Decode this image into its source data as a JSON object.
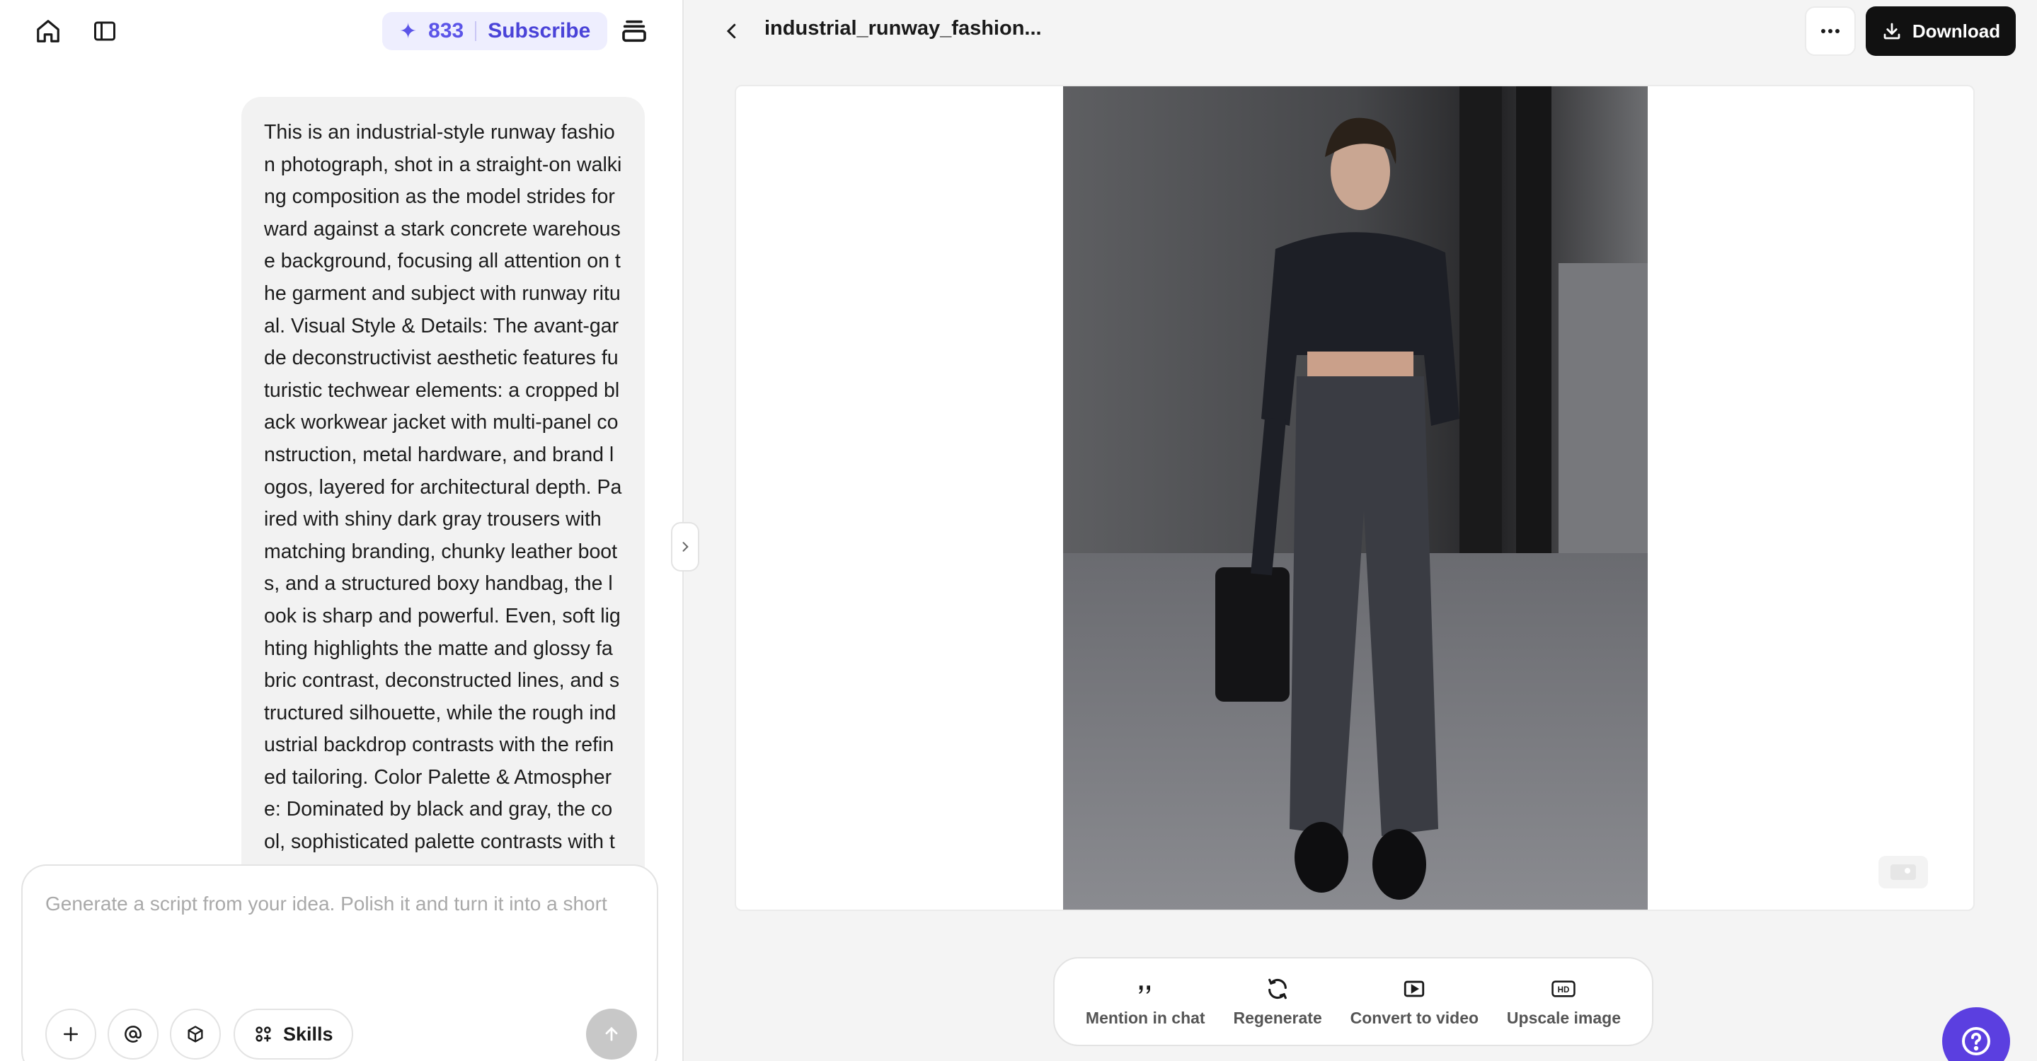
{
  "left_panel": {
    "credits": {
      "count": "833",
      "subscribe_label": "Subscribe"
    },
    "chat_message": "This is an industrial-style runway fashion photograph, shot in a straight-on walking composition as the model strides forward against a stark concrete warehouse background, focusing all attention on the garment and subject with runway ritual. Visual Style & Details: The avant-garde deconstructivist aesthetic features futuristic techwear elements: a cropped black workwear jacket with multi-panel construction, metal hardware, and brand logos, layered for architectural depth. Paired with shiny dark gray trousers with matching branding, chunky leather boots, and a structured boxy handbag, the look is sharp and powerful. Even, soft lighting highlights the matte and glossy fabric contrast, deconstructed lines, and structured silhouette, while the rough industrial backdrop contrasts with the refined tailoring. Color Palette & Atmosphere: Dominated by black and gray, the cool, sophisticated palette contrasts with the lights",
    "composer": {
      "placeholder": "Generate a script from your idea. Polish it and turn it into a short",
      "skills_label": "Skills"
    }
  },
  "right_panel": {
    "file_title": "industrial_runway_fashion...",
    "download_label": "Download",
    "actions": [
      {
        "label": "Mention in chat",
        "icon": "quote-icon"
      },
      {
        "label": "Regenerate",
        "icon": "refresh-icon"
      },
      {
        "label": "Convert to video",
        "icon": "video-icon"
      },
      {
        "label": "Upscale image",
        "icon": "hd-icon"
      }
    ]
  },
  "colors": {
    "accent": "#5b54e8",
    "download_bg": "#111111",
    "help_bg": "#5b3fe0"
  }
}
